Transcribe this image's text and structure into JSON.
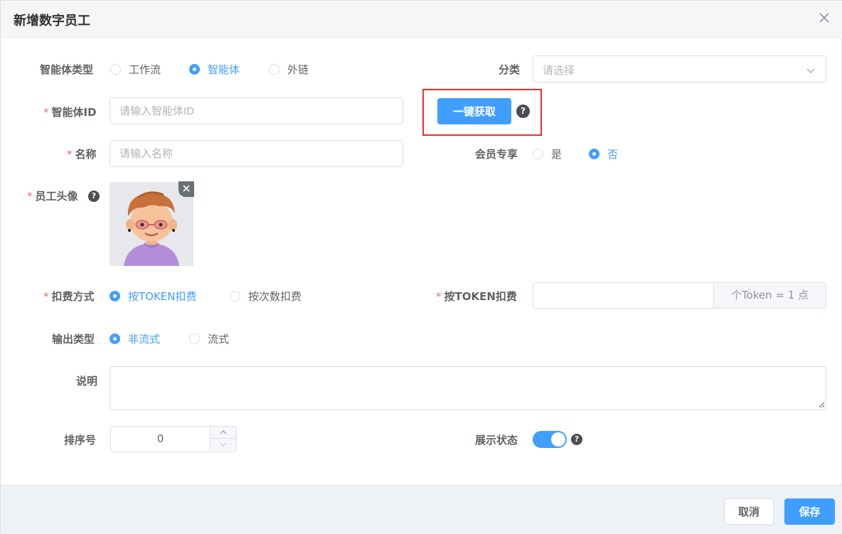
{
  "dialog": {
    "title": "新增数字员工"
  },
  "form": {
    "agent_type": {
      "label": "智能体类型",
      "options": [
        "工作流",
        "智能体",
        "外链"
      ],
      "selected": "智能体"
    },
    "category": {
      "label": "分类",
      "placeholder": "请选择"
    },
    "agent_id": {
      "label": "智能体ID",
      "placeholder": "请输入智能体ID",
      "fetch_button": "一键获取"
    },
    "name": {
      "label": "名称",
      "placeholder": "请输入名称"
    },
    "member_only": {
      "label": "会员专享",
      "options": [
        "是",
        "否"
      ],
      "selected": "否"
    },
    "avatar": {
      "label": "员工头像"
    },
    "billing_method": {
      "label": "扣费方式",
      "options": [
        "按TOKEN扣费",
        "按次数扣费"
      ],
      "selected": "按TOKEN扣费"
    },
    "token_billing": {
      "label": "按TOKEN扣费",
      "value": "",
      "suffix": "个Token = 1 点"
    },
    "output_type": {
      "label": "输出类型",
      "options": [
        "非流式",
        "流式"
      ],
      "selected": "非流式"
    },
    "description": {
      "label": "说明",
      "value": ""
    },
    "sort_order": {
      "label": "排序号",
      "value": "0"
    },
    "display_status": {
      "label": "展示状态",
      "enabled": true
    }
  },
  "icons": {
    "help": "?",
    "close": "close-icon",
    "chevron": "chevron-down-icon"
  },
  "footer": {
    "cancel_label": "取消",
    "save_label": "保存"
  },
  "colors": {
    "primary": "#409eff",
    "required": "#f56c6c",
    "highlight_box": "#f02a2a"
  }
}
